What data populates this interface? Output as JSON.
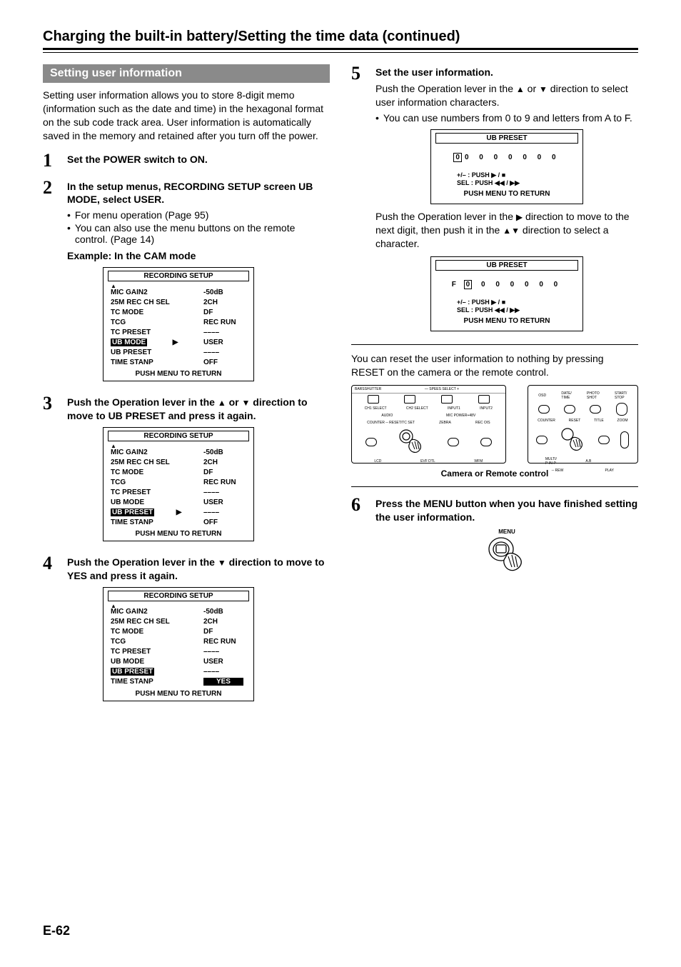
{
  "page_title": "Charging the built-in battery/Setting the time data (continued)",
  "section_banner": "Setting user information",
  "intro": "Setting user information allows you to store 8-digit memo (information such as the date and time) in the hexagonal format on the sub code track area. User information is automatically saved in the memory and retained after you turn off the power.",
  "steps": {
    "s1": {
      "num": "1",
      "heading": "Set the POWER switch to ON."
    },
    "s2": {
      "num": "2",
      "heading": "In the setup menus, RECORDING SETUP screen UB MODE, select USER.",
      "b1": "For menu operation (Page 95)",
      "b2": "You can also use the menu buttons on the remote control. (Page 14)",
      "example": "Example: In the CAM mode"
    },
    "s3": {
      "num": "3",
      "heading_a": "Push the Operation lever in the ",
      "heading_b": " or ",
      "heading_c": " direction to move to UB PRESET and press it again."
    },
    "s4": {
      "num": "4",
      "heading_a": "Push the Operation lever in the ",
      "heading_b": " direction to move to YES and press it again."
    },
    "s5": {
      "num": "5",
      "heading": "Set the user information.",
      "line_a": "Push the Operation lever in the ",
      "line_b": " or ",
      "line_c": " direction to select user information characters.",
      "bullet": "You can use numbers from 0 to 9 and letters from A to F.",
      "para2_a": "Push the Operation lever in the ",
      "para2_b": " direction to move to the next digit, then push it in the ",
      "para2_c": " direction to select a character.",
      "reset_para": "You can reset the user information to nothing by pressing RESET on the camera or the remote control.",
      "figure_caption": "Camera or Remote control"
    },
    "s6": {
      "num": "6",
      "heading": "Press the MENU button when you have finished setting the user information.",
      "menu_label": "MENU"
    }
  },
  "menu_common": {
    "title": "RECORDING SETUP",
    "footer": "PUSH  MENU TO RETURN",
    "up": "▲",
    "rows": {
      "mic_gain2": "MIC GAIN2",
      "rec_ch_sel": "25M REC CH SEL",
      "tc_mode": "TC MODE",
      "tcg": "TCG",
      "tc_preset": "TC PRESET",
      "ub_mode": "UB MODE",
      "ub_preset": "UB PRESET",
      "time_stanp": "TIME STANP"
    },
    "vals": {
      "m50db": "-50dB",
      "ch2": "2CH",
      "df": "DF",
      "rec_run": "REC RUN",
      "dashes": "––––",
      "user": "USER",
      "off": "OFF",
      "yes": "YES"
    },
    "cursor": "▶"
  },
  "ub_box": {
    "title": "UB PRESET",
    "footer": "PUSH  MENU TO RETURN",
    "ops1": "+/– : PUSH ▶ / ■",
    "ops2": "SEL : PUSH ◀◀ / ▶▶",
    "digits1_prefix": "",
    "digits1_rest": "0  0  0  0  0  0  0",
    "digits2_prefix": "F ",
    "digits2_boxed": "0",
    "digits2_rest": " 0  0  0  0  0  0",
    "digits1_boxed": "0"
  },
  "page_number": "E-62"
}
